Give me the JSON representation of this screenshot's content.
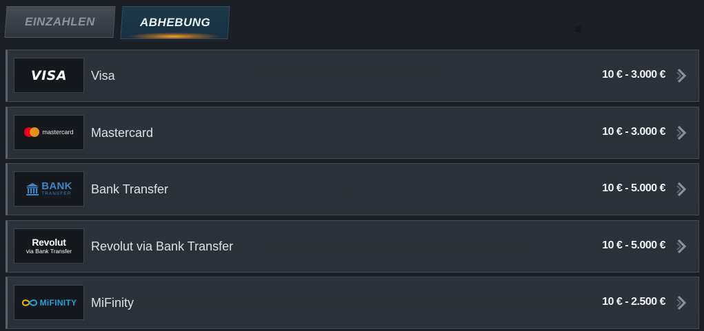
{
  "tabs": {
    "deposit_label": "EINZAHLEN",
    "withdraw_label": "ABHEBUNG",
    "active": "withdraw"
  },
  "methods": [
    {
      "name": "Visa",
      "limits": "10 € - 3.000 €",
      "logo": {
        "text": "VISA",
        "icon": "visa-logo"
      }
    },
    {
      "name": "Mastercard",
      "limits": "10 € - 3.000 €",
      "logo": {
        "text": "mastercard",
        "icon": "mastercard-logo"
      }
    },
    {
      "name": "Bank Transfer",
      "limits": "10 € - 5.000 €",
      "logo": {
        "text": "BANK",
        "subtext": "TRANSFER",
        "icon": "bank-building-icon"
      }
    },
    {
      "name": "Revolut via Bank Transfer",
      "limits": "10 € - 5.000 €",
      "logo": {
        "text": "Revolut",
        "subtext": "via Bank Transfer",
        "icon": "revolut-logo"
      }
    },
    {
      "name": "MiFinity",
      "limits": "10 € - 2.500 €",
      "logo": {
        "text": "MiFINITY",
        "icon": "infinity-icon"
      }
    }
  ],
  "colors": {
    "background": "#1c2026",
    "row_background": "#2d333a",
    "active_tab": "#183446",
    "active_tab_glow": "#ffaa32",
    "mastercard_red": "#eb001b",
    "mastercard_orange": "#f79e1b",
    "bank_blue": "#3f83c8",
    "mifinity_blue": "#2a9fd6"
  }
}
